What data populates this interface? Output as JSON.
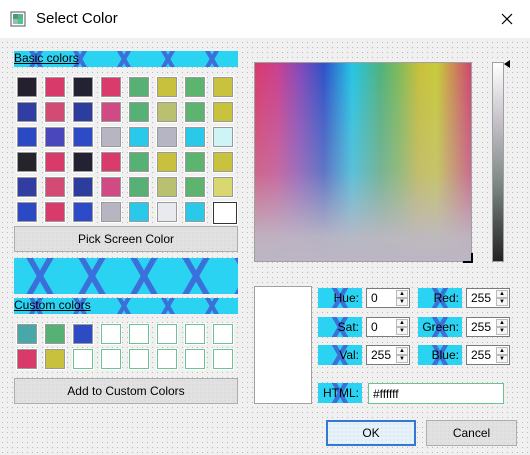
{
  "window": {
    "title": "Select Color",
    "icon": "color-dialog-icon"
  },
  "basic_colors": {
    "label": "Basic colors",
    "grid": [
      [
        "#24202e",
        "#d83a6a",
        "#232233",
        "#d93c6c",
        "#58b174",
        "#c8c13d",
        "#5db46f",
        "#c9c23e"
      ],
      [
        "#2f3ea0",
        "#d34a75",
        "#2c3d9e",
        "#d04b86",
        "#58b174",
        "#b9c070",
        "#5db46f",
        "#c9c23e"
      ],
      [
        "#2a49c3",
        "#4a47bd",
        "#2d4bc6",
        "#b6b5c1",
        "#2ac9ea",
        "#b6b5c3",
        "#2ac9ea",
        "#cff4f6"
      ],
      [
        "#25232c",
        "#d83a6a",
        "#232233",
        "#d93c6c",
        "#58b174",
        "#c8c13d",
        "#5db46f",
        "#c9c23e"
      ],
      [
        "#2f3ea0",
        "#d34a75",
        "#2c3d9e",
        "#d04b86",
        "#58b174",
        "#b9c070",
        "#5db46f",
        "#d9d870"
      ],
      [
        "#2a49c3",
        "#d83a6a",
        "#2d4bc6",
        "#b6b5c1",
        "#2ac9ea",
        "#e8eaf0",
        "#2ac9ea",
        "#ffffff"
      ]
    ]
  },
  "pick_screen_button": "Pick Screen Color",
  "custom_colors": {
    "label": "Custom colors",
    "row1": [
      "#4aa7a8",
      "#58b174",
      "#2c4bc4",
      "",
      "",
      "",
      "",
      ""
    ],
    "row2": [
      "#d83a6a",
      "#c8c13d",
      "",
      "",
      "",
      "",
      "",
      ""
    ]
  },
  "add_custom_button": "Add to Custom Colors",
  "fields": {
    "hue": {
      "label": "Hue:",
      "value": "0"
    },
    "sat": {
      "label": "Sat:",
      "value": "0"
    },
    "val": {
      "label": "Val:",
      "value": "255"
    },
    "red": {
      "label": "Red:",
      "value": "255"
    },
    "green": {
      "label": "Green:",
      "value": "255"
    },
    "blue": {
      "label": "Blue:",
      "value": "255"
    },
    "html": {
      "label": "HTML:",
      "value": "#ffffff"
    }
  },
  "buttons": {
    "ok": "OK",
    "cancel": "Cancel"
  },
  "colors": {
    "accent": "#3478d6",
    "hex_bg": "#2bd3f2",
    "hex_line": "#3b6fd9"
  }
}
